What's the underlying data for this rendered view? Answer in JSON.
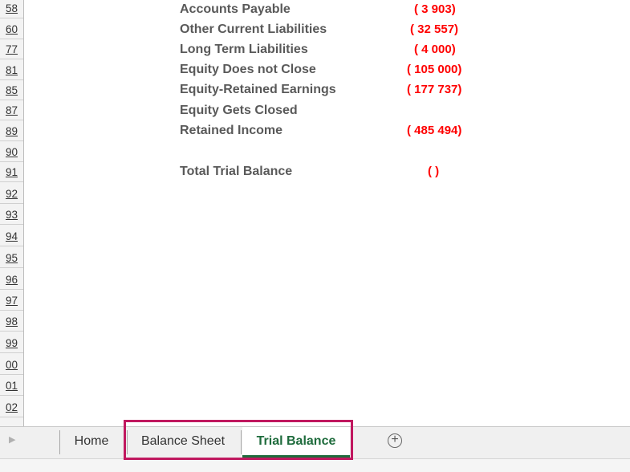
{
  "rows": [
    "58",
    "60",
    "77",
    "81",
    "85",
    "87",
    "89",
    "90",
    "91",
    "92",
    "93",
    "94",
    "95",
    "96",
    "97",
    "98",
    "99",
    "00",
    "01",
    "02"
  ],
  "lines": [
    {
      "label": "Accounts Payable",
      "value": "( 3 903)"
    },
    {
      "label": "Other Current Liabilities",
      "value": "( 32 557)"
    },
    {
      "label": "Long Term Liabilities",
      "value": "( 4 000)"
    },
    {
      "label": "Equity Does not Close",
      "value": "( 105 000)"
    },
    {
      "label": "Equity-Retained Earnings",
      "value": "( 177 737)"
    },
    {
      "label": "Equity Gets Closed",
      "value": ""
    },
    {
      "label": "Retained Income",
      "value": "( 485 494)"
    },
    {
      "label": "",
      "value": ""
    },
    {
      "label": "Total Trial Balance",
      "value": "(  )"
    }
  ],
  "tabs": {
    "home": "Home",
    "balance_sheet": "Balance Sheet",
    "trial_balance": "Trial Balance",
    "active": "Trial Balance"
  },
  "icons": {
    "nav": "triangle-right-icon",
    "add": "plus-circle-icon"
  },
  "colors": {
    "negative": "#ff0000",
    "active_tab": "#1e6b3c",
    "highlight": "#c0185f"
  }
}
